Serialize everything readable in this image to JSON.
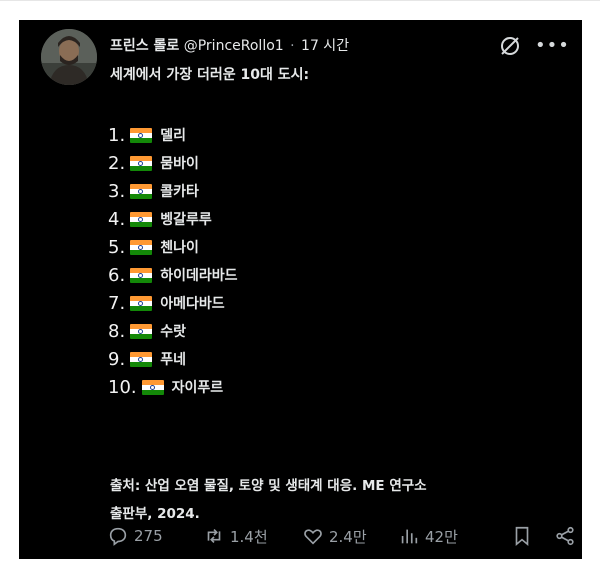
{
  "author": {
    "name": "프린스 롤로",
    "handle": "@PrinceRollo1",
    "separator": "·",
    "time": "17 시간"
  },
  "post": {
    "headline": "세계에서 가장 더러운 10대 도시:",
    "cities": [
      {
        "rank": "1.",
        "name": "델리"
      },
      {
        "rank": "2.",
        "name": "뭄바이"
      },
      {
        "rank": "3.",
        "name": "콜카타"
      },
      {
        "rank": "4.",
        "name": "벵갈루루"
      },
      {
        "rank": "5.",
        "name": "첸나이"
      },
      {
        "rank": "6.",
        "name": "하이데라바드"
      },
      {
        "rank": "7.",
        "name": "아메다바드"
      },
      {
        "rank": "8.",
        "name": "수랏"
      },
      {
        "rank": "9.",
        "name": "푸네"
      },
      {
        "rank": "10.",
        "name": "자이푸르"
      }
    ],
    "flag_icon": "india-flag-icon",
    "source_line1": "출처: 산업 오염 물질, 토양 및 생태계 대응. ME 연구소",
    "source_line2": "출판부, 2024."
  },
  "actions": {
    "replies": "275",
    "reposts": "1.4천",
    "likes": "2.4만",
    "views": "42만"
  },
  "colors": {
    "background": "#000000",
    "text": "#e7e9ea",
    "muted": "#9aa0a6",
    "flag_saffron": "#ff9933",
    "flag_green": "#138808"
  }
}
